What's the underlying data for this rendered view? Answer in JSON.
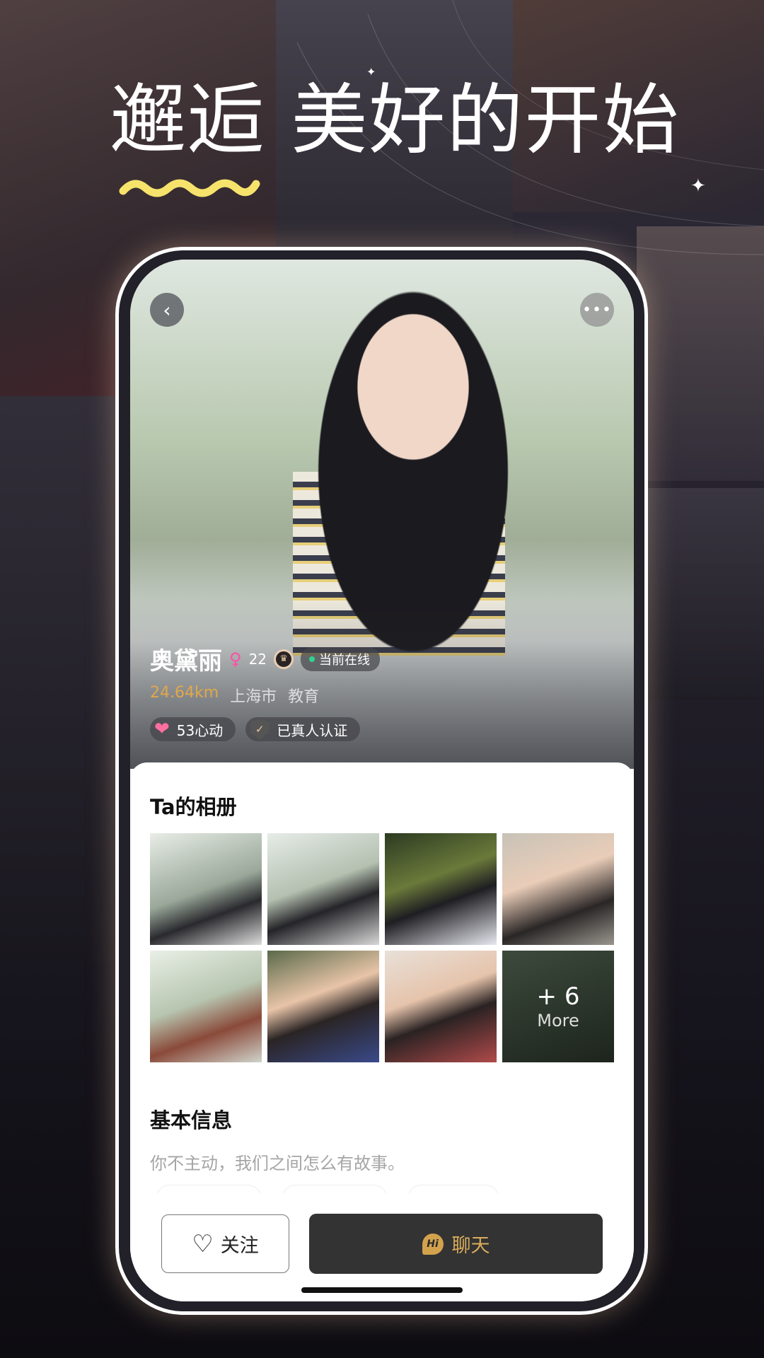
{
  "headline": "邂逅 美好的开始",
  "colors": {
    "accent_gold": "#e0a84b",
    "wave_yellow": "#f7e36b",
    "online_green": "#2fd48c",
    "chat_button": "#333333",
    "gender_pink": "#ff4fa6"
  },
  "nav": {
    "back_icon": "chevron-left-icon",
    "more_icon": "more-dots-icon",
    "back_glyph": "‹",
    "more_glyph": "•••"
  },
  "profile": {
    "name": "奥黛丽",
    "gender_glyph": "♀",
    "age": "22",
    "crown_glyph": "♛",
    "status": "当前在线",
    "distance": "24.64km",
    "city": "上海市",
    "occupation": "教育",
    "likes": "53心动",
    "verified": "已真人认证",
    "check_glyph": "✓",
    "heart_glyph": "❤"
  },
  "album": {
    "title": "Ta的相册",
    "more_count": "+ 6",
    "more_label": "More"
  },
  "basic": {
    "title": "基本信息",
    "motto": "你不主动，我们之间怎么有故事。"
  },
  "actions": {
    "follow": "关注",
    "follow_glyph": "♡",
    "chat": "聊天",
    "hi_badge": "Hi"
  }
}
